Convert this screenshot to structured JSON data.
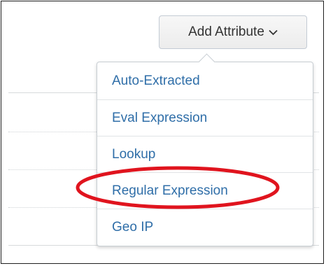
{
  "add_attribute_button": {
    "label": "Add Attribute",
    "icon": "chevron-down-icon"
  },
  "dropdown_menu": {
    "items": [
      {
        "label": "Auto-Extracted"
      },
      {
        "label": "Eval Expression"
      },
      {
        "label": "Lookup"
      },
      {
        "label": "Regular Expression",
        "annotated": true
      },
      {
        "label": "Geo IP"
      }
    ]
  },
  "colors": {
    "menu_link": "#2f6ea8",
    "annotation_ellipse": "#e0141e",
    "button_text": "#333333",
    "button_border": "#c3cbd4"
  }
}
